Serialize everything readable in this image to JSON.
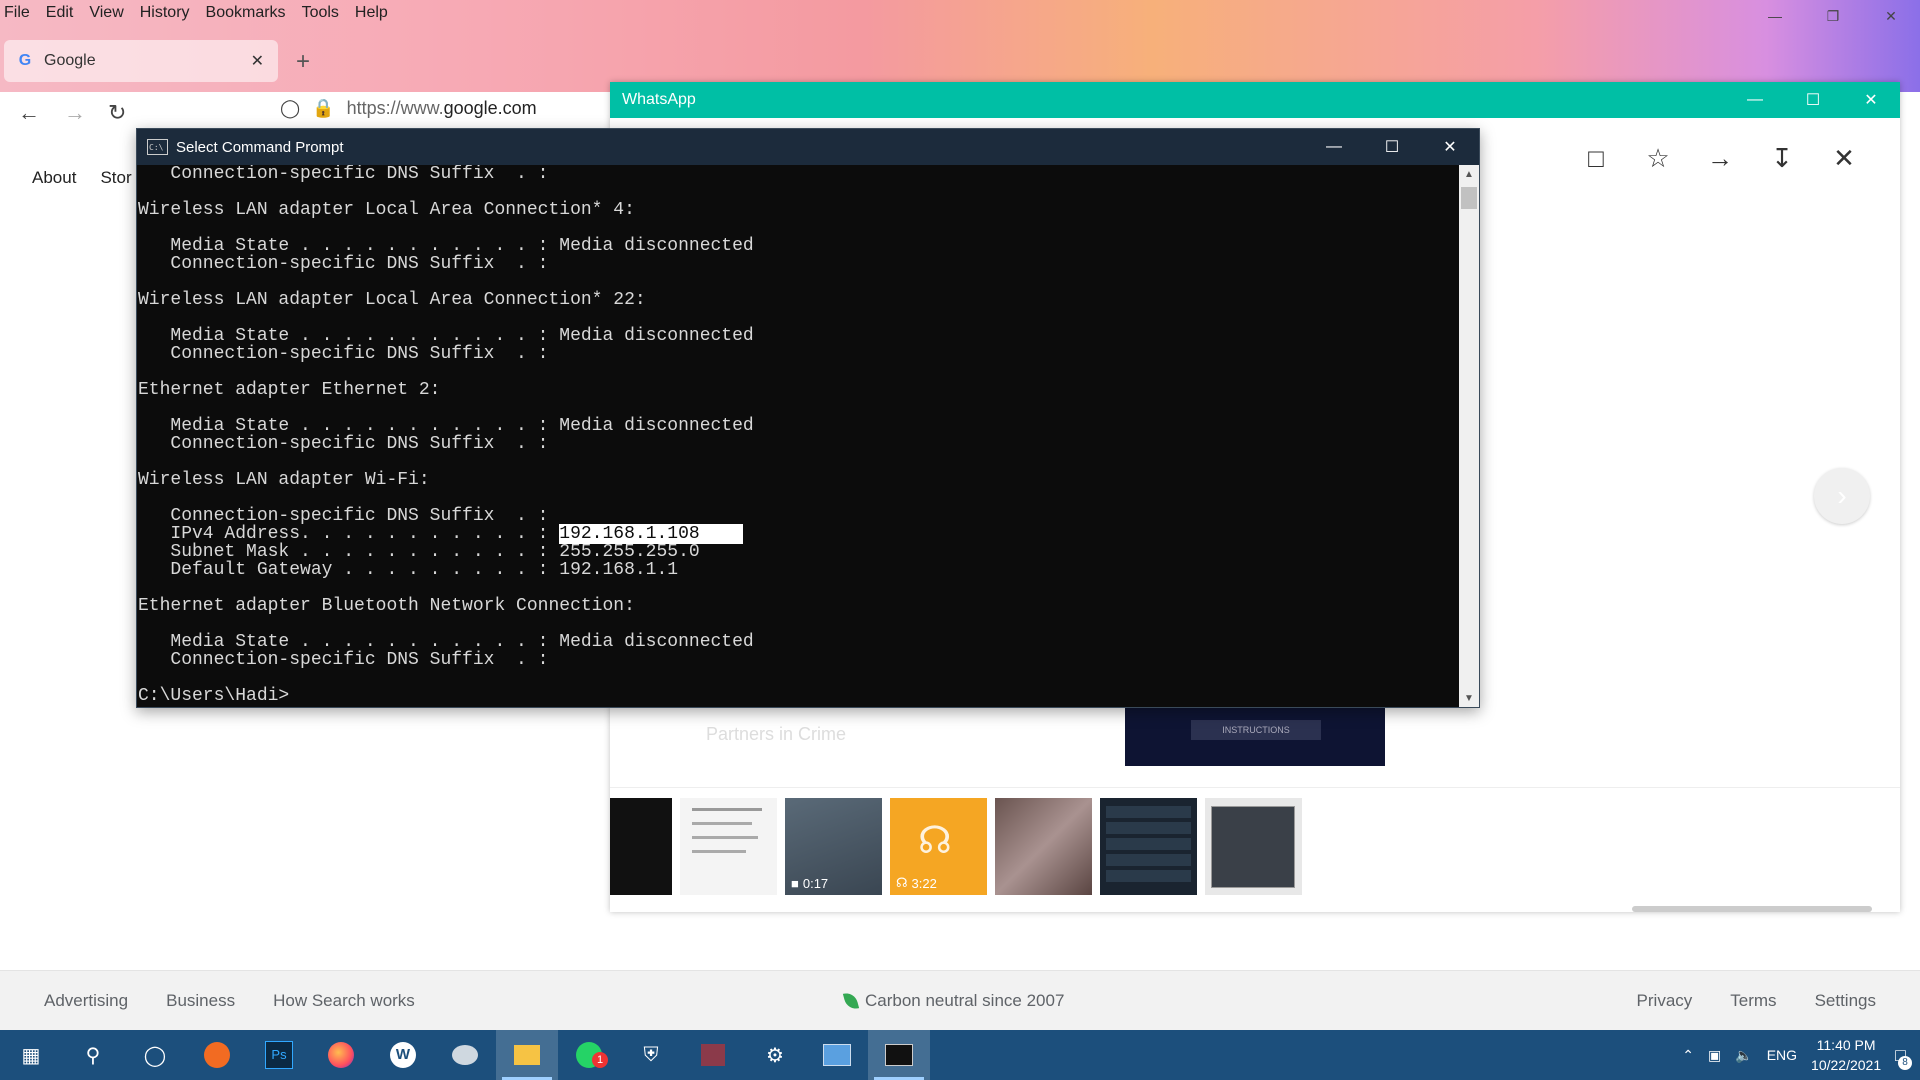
{
  "browser": {
    "menu": [
      "File",
      "Edit",
      "View",
      "History",
      "Bookmarks",
      "Tools",
      "Help"
    ],
    "tab_title": "Google",
    "url_prefix": "https://www.",
    "url_domain": "google.com"
  },
  "google": {
    "top_links": [
      "About",
      "Stor"
    ],
    "footer_left": [
      "Advertising",
      "Business",
      "How Search works"
    ],
    "footer_mid": "Carbon neutral since 2007",
    "footer_right": [
      "Privacy",
      "Terms",
      "Settings"
    ]
  },
  "whatsapp": {
    "title": "WhatsApp",
    "chat_name_faded": "Partners in Crime",
    "preview_label": "INSTRUCTIONS",
    "thumb_labels": {
      "video_duration": "0:17",
      "audio_duration": "3:22"
    }
  },
  "cmd": {
    "title": "Select Command Prompt",
    "lines": [
      "   Connection-specific DNS Suffix  . :",
      "",
      "Wireless LAN adapter Local Area Connection* 4:",
      "",
      "   Media State . . . . . . . . . . . : Media disconnected",
      "   Connection-specific DNS Suffix  . :",
      "",
      "Wireless LAN adapter Local Area Connection* 22:",
      "",
      "   Media State . . . . . . . . . . . : Media disconnected",
      "   Connection-specific DNS Suffix  . :",
      "",
      "Ethernet adapter Ethernet 2:",
      "",
      "   Media State . . . . . . . . . . . : Media disconnected",
      "   Connection-specific DNS Suffix  . :",
      "",
      "Wireless LAN adapter Wi-Fi:",
      "",
      "   Connection-specific DNS Suffix  . :"
    ],
    "ipv4_label": "   IPv4 Address. . . . . . . . . . . : ",
    "ipv4_value": "192.168.1.108",
    "lines_after": [
      "   Subnet Mask . . . . . . . . . . . : 255.255.255.0",
      "   Default Gateway . . . . . . . . . : 192.168.1.1",
      "",
      "Ethernet adapter Bluetooth Network Connection:",
      "",
      "   Media State . . . . . . . . . . . : Media disconnected",
      "   Connection-specific DNS Suffix  . :",
      "",
      "C:\\Users\\Hadi>"
    ]
  },
  "taskbar": {
    "language": "ENG",
    "time": "11:40 PM",
    "date": "10/22/2021",
    "notification_count": "8",
    "whatsapp_badge": "1"
  },
  "colors": {
    "whatsapp_title": "#00bfa5",
    "cmd_title": "#1c2b3c",
    "taskbar": "#1c4f7c"
  }
}
